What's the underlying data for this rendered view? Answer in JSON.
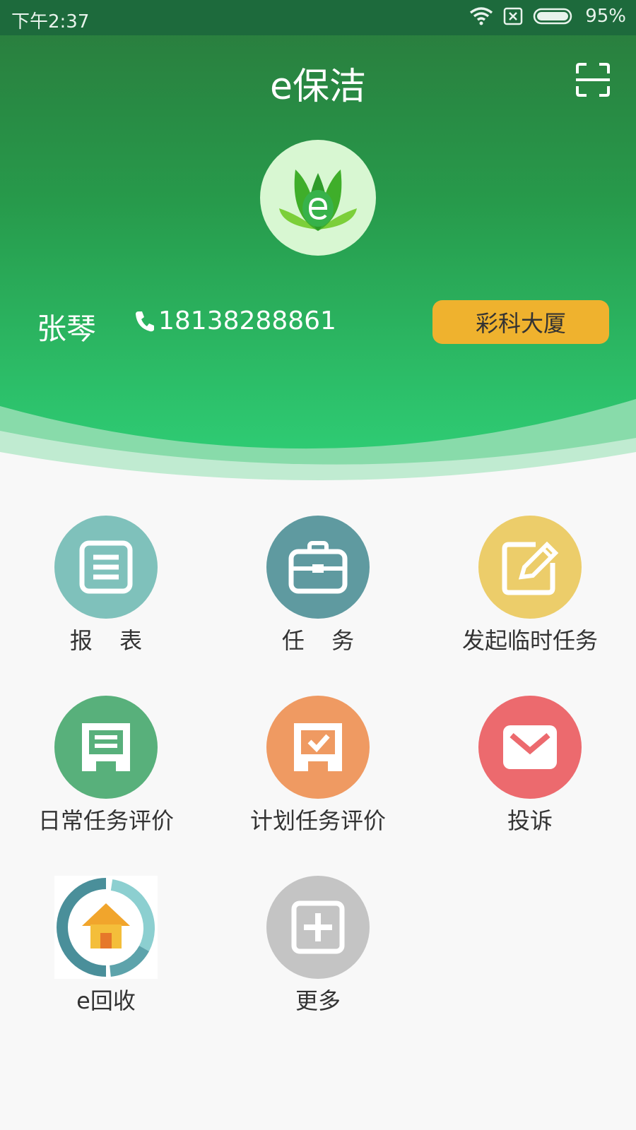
{
  "status_bar": {
    "time": "下午2:37",
    "battery": "95%",
    "icons": [
      "wifi-icon",
      "no-sim-icon",
      "battery-icon"
    ]
  },
  "header": {
    "title": "e保洁",
    "scan_icon": "scan-icon",
    "logo_icon": "leaf-e-logo"
  },
  "user": {
    "name": "张琴",
    "phone": "18138288861",
    "phone_icon": "phone-icon",
    "building": "彩科大厦"
  },
  "menu": [
    {
      "label": "报 表",
      "icon": "report-icon",
      "color": "#7fc1bb"
    },
    {
      "label": "任 务",
      "icon": "briefcase-icon",
      "color": "#5f9aa0"
    },
    {
      "label": "发起临时任务",
      "icon": "edit-icon",
      "color": "#eccd6a"
    },
    {
      "label": "日常任务评价",
      "icon": "daily-eval-icon",
      "color": "#58b07b"
    },
    {
      "label": "计划任务评价",
      "icon": "plan-eval-icon",
      "color": "#ef9a62"
    },
    {
      "label": "投诉",
      "icon": "mail-icon",
      "color": "#ec6a6e"
    },
    {
      "label": "e回收",
      "icon": "recycle-house-icon",
      "color": "#ffffff"
    },
    {
      "label": "更多",
      "icon": "plus-icon",
      "color": "#c4c4c4"
    }
  ],
  "colors": {
    "header_top": "#2a7a3c",
    "header_bottom": "#2ecb73",
    "building_button": "#efb22e",
    "background": "#f8f8f8"
  }
}
